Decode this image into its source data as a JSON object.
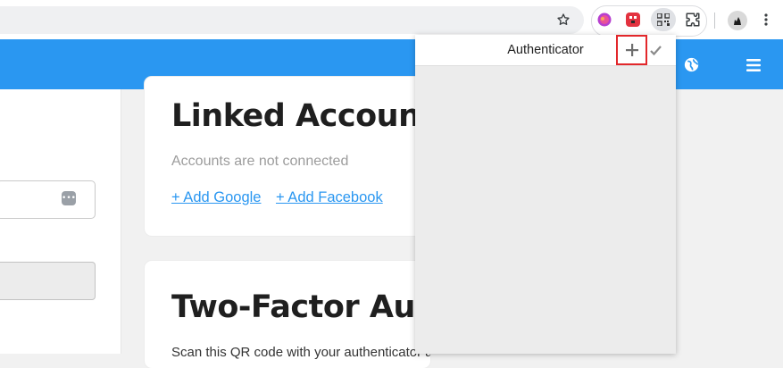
{
  "popup": {
    "title": "Authenticator"
  },
  "linked_accounts": {
    "heading": "Linked Accounts",
    "status": "Accounts are not connected",
    "add_google": "+ Add Google",
    "add_facebook": "+ Add Facebook"
  },
  "two_factor": {
    "heading": "Two-Factor Authentication",
    "instructions": "Scan this QR code with your authenticator app"
  },
  "colors": {
    "header_blue": "#2a97f1",
    "highlight_red": "#e2272b"
  }
}
